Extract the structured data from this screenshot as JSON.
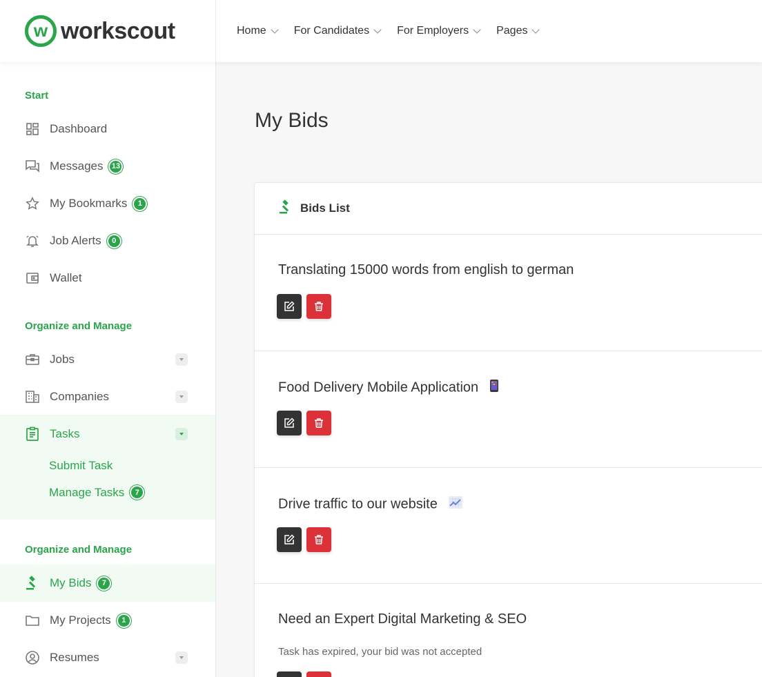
{
  "brand": {
    "name": "workscout",
    "logo_letter": "w",
    "color": "#2aa54a"
  },
  "nav": [
    {
      "label": "Home"
    },
    {
      "label": "For Candidates"
    },
    {
      "label": "For Employers"
    },
    {
      "label": "Pages"
    }
  ],
  "sidebar": {
    "section1": "Start",
    "dashboard": "Dashboard",
    "messages": {
      "label": "Messages",
      "badge": "13"
    },
    "bookmarks": {
      "label": "My Bookmarks",
      "badge": "1"
    },
    "job_alerts": {
      "label": "Job Alerts",
      "badge": "0"
    },
    "wallet": "Wallet",
    "section2": "Organize and Manage",
    "jobs": "Jobs",
    "companies": "Companies",
    "tasks": "Tasks",
    "submit_task": "Submit Task",
    "manage_tasks": {
      "label": "Manage Tasks",
      "badge": "7"
    },
    "section3": "Organize and Manage",
    "my_bids": {
      "label": "My Bids",
      "badge": "7"
    },
    "my_projects": {
      "label": "My Projects",
      "badge": "1"
    },
    "resumes": "Resumes"
  },
  "main": {
    "title": "My Bids",
    "card_title": "Bids List",
    "bids": [
      {
        "title": "Translating 15000 words from english to german"
      },
      {
        "title": "Food Delivery Mobile Application",
        "emoji": "mobile-phone"
      },
      {
        "title": "Drive traffic to our website",
        "emoji": "chart-increasing"
      },
      {
        "title": "Need an Expert Digital Marketing & SEO",
        "note": "Task has expired, your bid was not accepted"
      }
    ]
  }
}
